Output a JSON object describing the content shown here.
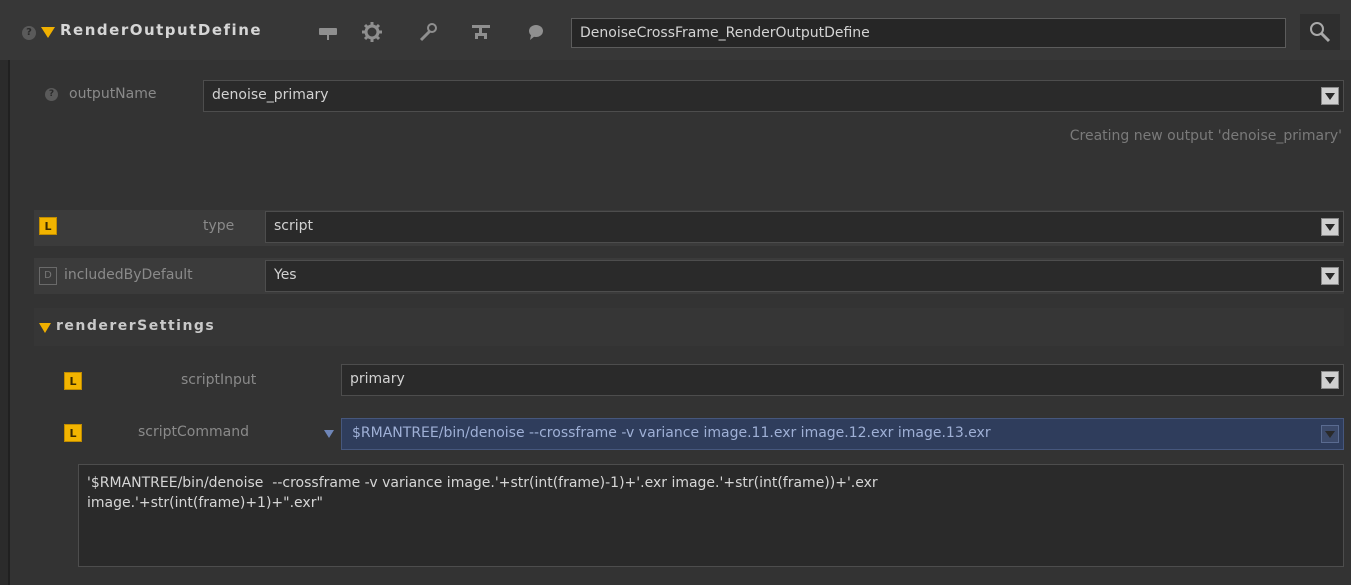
{
  "header": {
    "help_glyph": "?",
    "title": "RenderOutputDefine",
    "node_name": "DenoiseCrossFrame_RenderOutputDefine",
    "icons": [
      "pin-icon",
      "gear-icon",
      "wrench-icon",
      "hierarchy-icon",
      "comment-icon",
      "search-icon"
    ]
  },
  "outputName": {
    "help_glyph": "?",
    "label": "outputName",
    "value": "denoise_primary",
    "status": "Creating new output 'denoise_primary'"
  },
  "type": {
    "badge": "L",
    "label": "type",
    "value": "script"
  },
  "includedByDefault": {
    "badge": "D",
    "label": "includedByDefault",
    "value": "Yes"
  },
  "rendererSettings": {
    "label": "rendererSettings",
    "scriptInput": {
      "badge": "L",
      "label": "scriptInput",
      "value": "primary"
    },
    "scriptCommand": {
      "badge": "L",
      "label": "scriptCommand",
      "evaluated": "$RMANTREE/bin/denoise  --crossframe -v variance image.11.exr image.12.exr image.13.exr",
      "expression": "'$RMANTREE/bin/denoise  --crossframe -v variance image.'+str(int(frame)-1)+'.exr image.'+str(int(frame))+'.exr\nimage.'+str(int(frame)+1)+\".exr\""
    }
  },
  "colors": {
    "accent": "#f2b400",
    "background": "#333333",
    "header": "#373737",
    "expression_field": "#2f3d5c"
  }
}
